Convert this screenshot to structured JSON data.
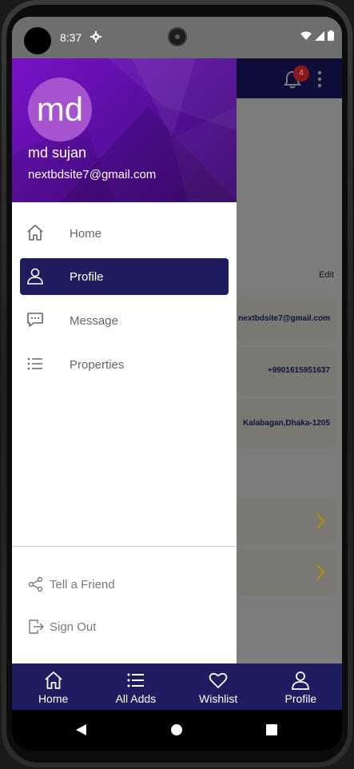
{
  "status_bar": {
    "time": "8:37"
  },
  "app_bar": {
    "notification_count": "4"
  },
  "drawer": {
    "avatar_initials": "md",
    "user_name": "md sujan",
    "user_email": "nextbdsite7@gmail.com",
    "menu": [
      {
        "label": "Home",
        "icon": "home-icon",
        "active": false
      },
      {
        "label": "Profile",
        "icon": "person-icon",
        "active": true
      },
      {
        "label": "Message",
        "icon": "message-icon",
        "active": false
      },
      {
        "label": "Properties",
        "icon": "list-icon",
        "active": false
      }
    ],
    "footer": [
      {
        "label": "Tell a Friend",
        "icon": "share-icon"
      },
      {
        "label": "Sign Out",
        "icon": "sign-out-icon"
      }
    ]
  },
  "background_profile": {
    "edit_label": "Edit",
    "email": "nextbdsite7@gmail.com",
    "phone": "+9901615951637",
    "address": "Kalabagan,Dhaka-1205"
  },
  "bottom_nav": [
    {
      "label": "Home",
      "icon": "home-icon"
    },
    {
      "label": "All Adds",
      "icon": "list-icon"
    },
    {
      "label": "Wishlist",
      "icon": "heart-icon"
    },
    {
      "label": "Profile",
      "icon": "person-icon"
    }
  ],
  "colors": {
    "drawer_header_start": "#7a12c8",
    "drawer_header_end": "#3d0a6e",
    "active_item": "#1f1c5f",
    "bottom_nav": "#1f1c5f",
    "app_bar": "#0f0e3a",
    "badge": "#8a1a1a",
    "chevron": "#b08a1a"
  }
}
